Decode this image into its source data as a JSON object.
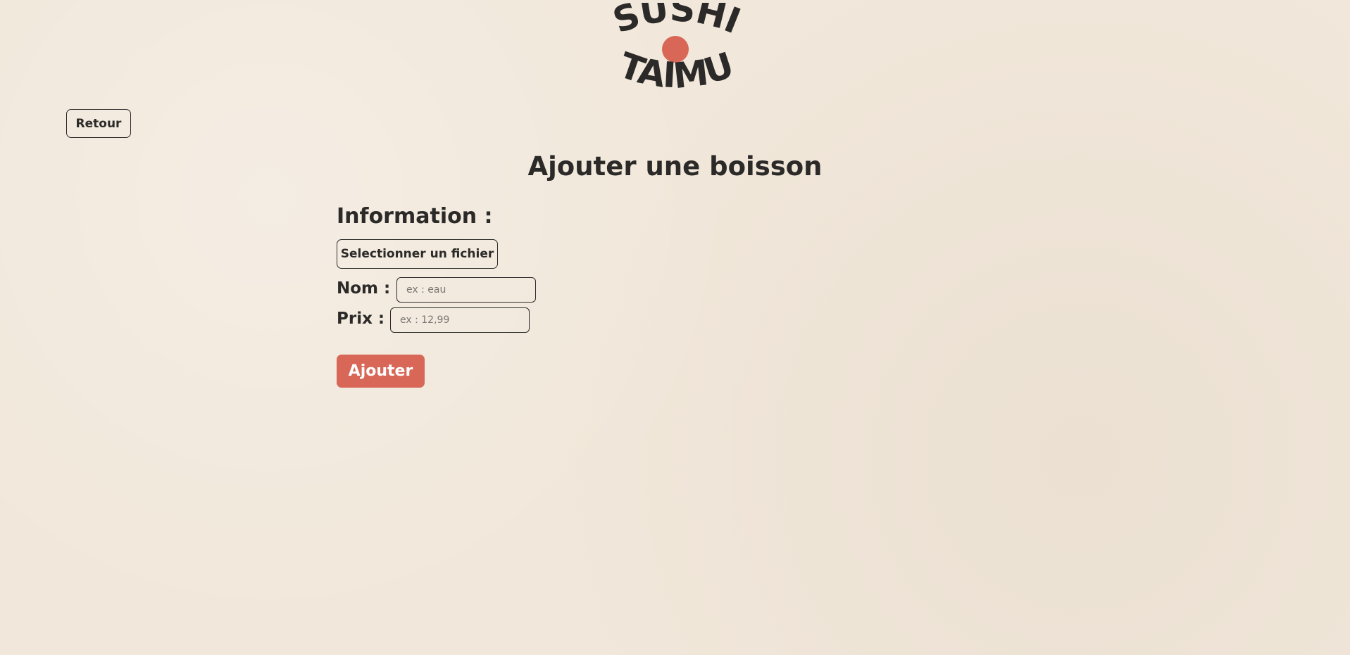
{
  "brand": {
    "logo_line1": "SUSHI",
    "logo_line2": "TAIMU",
    "accent_color": "#d86757",
    "text_color": "#2b2a28",
    "background_color": "#f1e7da"
  },
  "nav": {
    "back_label": "Retour"
  },
  "page": {
    "title": "Ajouter une boisson"
  },
  "form": {
    "section_title": "Information :",
    "file_button_label": "Selectionner un fichier",
    "name_label": "Nom :",
    "name_placeholder": "ex : eau",
    "name_value": "",
    "price_label": "Prix :",
    "price_placeholder": "ex : 12,99",
    "price_value": "",
    "submit_label": "Ajouter"
  }
}
